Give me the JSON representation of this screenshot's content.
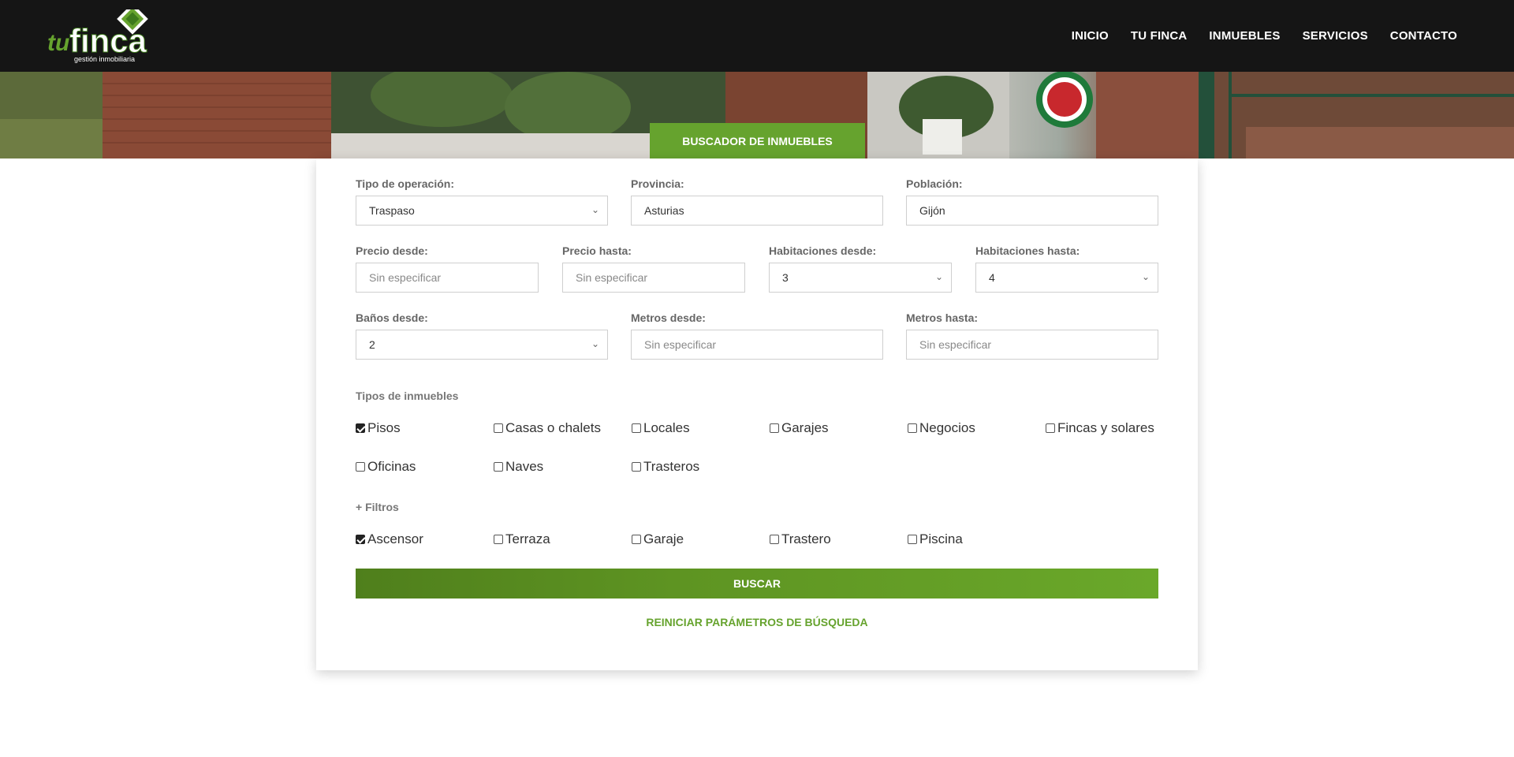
{
  "brand": {
    "logo_text": "tufinca",
    "logo_sub": "gestión inmobiliaria"
  },
  "nav": {
    "items": [
      "INICIO",
      "TU FINCA",
      "INMUEBLES",
      "SERVICIOS",
      "CONTACTO"
    ]
  },
  "hero": {
    "tab_label": "BUSCADOR DE INMUEBLES"
  },
  "form": {
    "operacion": {
      "label": "Tipo de operación:",
      "value": "Traspaso"
    },
    "provincia": {
      "label": "Provincia:",
      "value": "Asturias"
    },
    "poblacion": {
      "label": "Población:",
      "value": "Gijón"
    },
    "precio_desde": {
      "label": "Precio desde:",
      "placeholder": "Sin especificar"
    },
    "precio_hasta": {
      "label": "Precio hasta:",
      "placeholder": "Sin especificar"
    },
    "hab_desde": {
      "label": "Habitaciones desde:",
      "value": "3"
    },
    "hab_hasta": {
      "label": "Habitaciones hasta:",
      "value": "4"
    },
    "banos_desde": {
      "label": "Baños desde:",
      "value": "2"
    },
    "metros_desde": {
      "label": "Metros desde:",
      "placeholder": "Sin especificar"
    },
    "metros_hasta": {
      "label": "Metros hasta:",
      "placeholder": "Sin especificar"
    },
    "tipos_title": "Tipos de inmuebles",
    "tipos": [
      {
        "label": "Pisos",
        "checked": true
      },
      {
        "label": "Casas o chalets",
        "checked": false
      },
      {
        "label": "Locales",
        "checked": false
      },
      {
        "label": "Garajes",
        "checked": false
      },
      {
        "label": "Negocios",
        "checked": false
      },
      {
        "label": "Fincas y solares",
        "checked": false
      },
      {
        "label": "Oficinas",
        "checked": false
      },
      {
        "label": "Naves",
        "checked": false
      },
      {
        "label": "Trasteros",
        "checked": false
      }
    ],
    "filtros_title": "+ Filtros",
    "filtros": [
      {
        "label": "Ascensor",
        "checked": true
      },
      {
        "label": "Terraza",
        "checked": false
      },
      {
        "label": "Garaje",
        "checked": false
      },
      {
        "label": "Trastero",
        "checked": false
      },
      {
        "label": "Piscina",
        "checked": false
      }
    ],
    "buscar_label": "BUSCAR",
    "reset_label": "REINICIAR PARÁMETROS DE BÚSQUEDA"
  },
  "colors": {
    "accent": "#66a32e",
    "header_bg": "#151515"
  }
}
